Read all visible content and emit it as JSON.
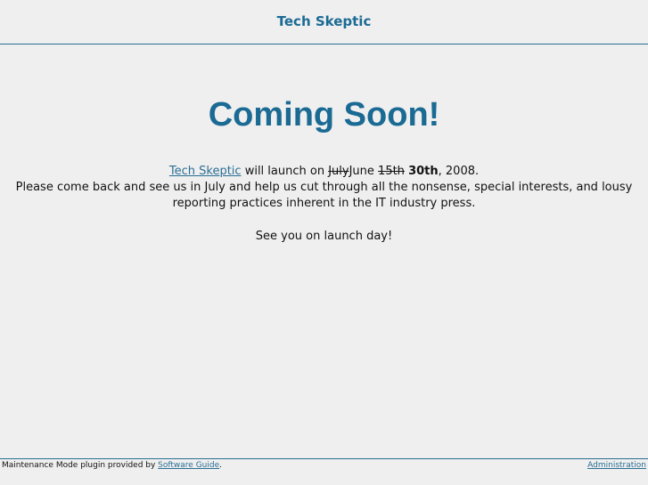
{
  "header": {
    "site_title": "Tech Skeptic"
  },
  "main": {
    "heading": "Coming Soon!",
    "launch": {
      "link_text": "Tech Skeptic",
      "mid_text": " will launch on ",
      "struck_month": "July",
      "new_month": "June ",
      "struck_day": "15th",
      "space": " ",
      "new_day": "30th",
      "year_text": ", 2008."
    },
    "paragraph": "Please come back and see us in July and help us cut through all the nonsense, special interests, and lousy reporting practices inherent in the IT industry press.",
    "closing": "See you on launch day!"
  },
  "footer": {
    "left_text": "Maintenance Mode plugin provided by ",
    "left_link": "Software Guide",
    "left_period": ".",
    "right_link": "Administration"
  },
  "colors": {
    "accent": "#1a6a94",
    "background": "#efefef"
  }
}
